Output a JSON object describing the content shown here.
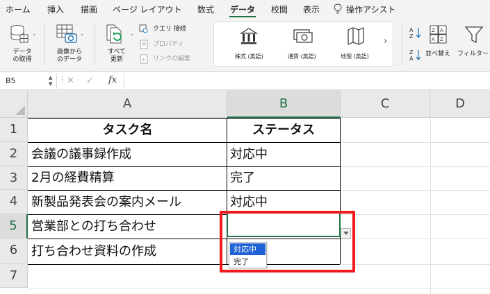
{
  "menu": {
    "tabs": [
      "ホーム",
      "挿入",
      "描画",
      "ページ レイアウト",
      "数式",
      "データ",
      "校閲",
      "表示"
    ],
    "active_tab": "データ",
    "assist_label": "操作アシスト"
  },
  "ribbon": {
    "get_data": "データ\nの取得",
    "from_image": "画像から\nのデータ",
    "refresh_all": "すべて\n更新",
    "queries": "クエリ 接続",
    "properties": "プロパティ",
    "edit_links": "リンクの編集",
    "stocks": "株式 (英語)",
    "currencies": "通貨 (英語)",
    "geography": "地理 (英語)",
    "sort": "並べ替え",
    "filter": "フィルター"
  },
  "formula_bar": {
    "name_box": "B5",
    "fx": "fx",
    "cancel": "✕",
    "enter": "✓",
    "formula": ""
  },
  "grid": {
    "columns": [
      "A",
      "B",
      "C",
      "D"
    ],
    "rows": [
      "1",
      "2",
      "3",
      "4",
      "5",
      "6",
      "7"
    ],
    "header": {
      "a": "タスク名",
      "b": "ステータス"
    },
    "data": [
      {
        "a": "会議の議事録作成",
        "b": "対応中"
      },
      {
        "a": "2月の経費精算",
        "b": "完了"
      },
      {
        "a": "新製品発表会の案内メール",
        "b": "対応中"
      },
      {
        "a": "営業部との打ち合わせ",
        "b": ""
      },
      {
        "a": "打ち合わせ資料の作成",
        "b": ""
      }
    ]
  },
  "dropdown": {
    "options": [
      "対応中",
      "完了"
    ],
    "selected": "対応中"
  },
  "colors": {
    "excel_green": "#1e7145",
    "highlight_red": "#f21a1a",
    "selection_blue": "#1f62d6"
  }
}
